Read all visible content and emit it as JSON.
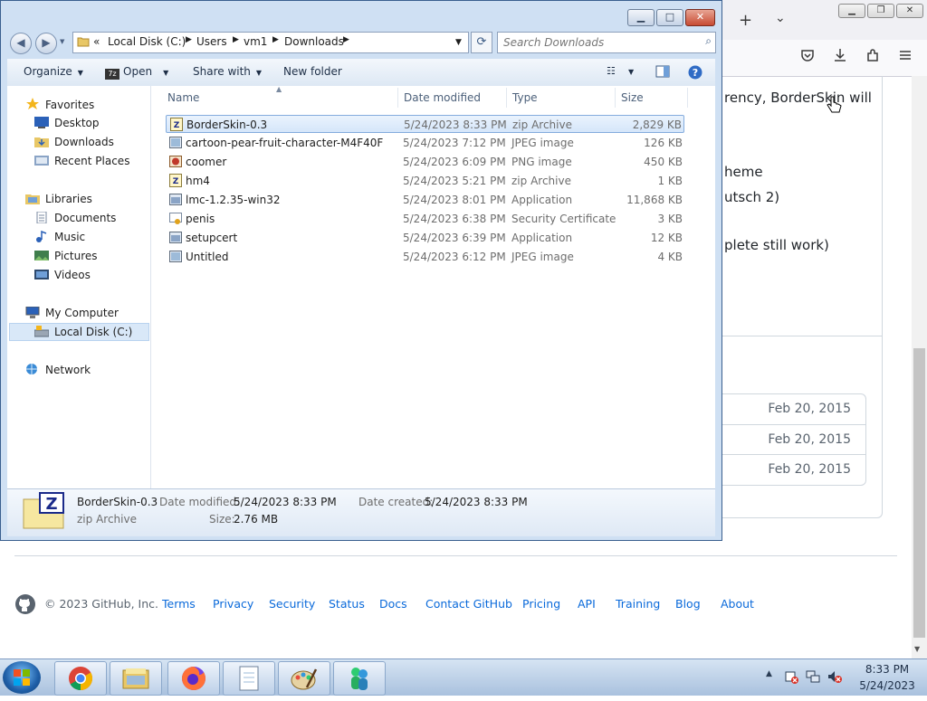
{
  "firefox": {
    "new_tab_icon": "plus-icon",
    "tab_list_icon": "chevron-down-icon",
    "toolbar_icons": [
      "pocket-icon",
      "download-icon",
      "extensions-icon",
      "menu-icon"
    ],
    "window_buttons": {
      "minimize": "minimize-icon",
      "restore": "restore-icon",
      "close": "close-icon"
    }
  },
  "github_page": {
    "text_lines": [
      "rency, BorderSkin will",
      "heme",
      "utsch 2)",
      "plete still work)"
    ],
    "release_dates": [
      "Feb 20, 2015",
      "Feb 20, 2015",
      "Feb 20, 2015"
    ],
    "footer": {
      "copyright": "© 2023 GitHub, Inc.",
      "links": [
        "Terms",
        "Privacy",
        "Security",
        "Status",
        "Docs",
        "Contact GitHub",
        "Pricing",
        "API",
        "Training",
        "Blog",
        "About"
      ]
    }
  },
  "explorer": {
    "breadcrumb": {
      "overflow": "«",
      "parts": [
        "Local Disk (C:)",
        "Users",
        "vm1",
        "Downloads"
      ]
    },
    "search_placeholder": "Search Downloads",
    "commands": {
      "organize": "Organize",
      "open": "Open",
      "share_with": "Share with",
      "new_folder": "New folder"
    },
    "nav": {
      "favorites_header": "Favorites",
      "favorites": [
        "Desktop",
        "Downloads",
        "Recent Places"
      ],
      "libraries_header": "Libraries",
      "libraries": [
        "Documents",
        "Music",
        "Pictures",
        "Videos"
      ],
      "computer_header": "My Computer",
      "computer_items": [
        "Local Disk (C:)"
      ],
      "network": "Network"
    },
    "columns": {
      "name": "Name",
      "date_modified": "Date modified",
      "type": "Type",
      "size": "Size"
    },
    "files": [
      {
        "name": "BorderSkin-0.3",
        "date": "5/24/2023 8:33 PM",
        "type": "zip Archive",
        "size": "2,829 KB",
        "icon": "zip-archive-icon"
      },
      {
        "name": "cartoon-pear-fruit-character-M4F40F",
        "date": "5/24/2023 7:12 PM",
        "type": "JPEG image",
        "size": "126 KB",
        "icon": "jpeg-image-icon"
      },
      {
        "name": "coomer",
        "date": "5/24/2023 6:09 PM",
        "type": "PNG image",
        "size": "450 KB",
        "icon": "png-image-icon"
      },
      {
        "name": "hm4",
        "date": "5/24/2023 5:21 PM",
        "type": "zip Archive",
        "size": "1 KB",
        "icon": "zip-archive-icon"
      },
      {
        "name": "lmc-1.2.35-win32",
        "date": "5/24/2023 8:01 PM",
        "type": "Application",
        "size": "11,868 KB",
        "icon": "application-icon"
      },
      {
        "name": "penis",
        "date": "5/24/2023 6:38 PM",
        "type": "Security Certificate",
        "size": "3 KB",
        "icon": "certificate-icon"
      },
      {
        "name": "setupcert",
        "date": "5/24/2023 6:39 PM",
        "type": "Application",
        "size": "12 KB",
        "icon": "application-icon"
      },
      {
        "name": "Untitled",
        "date": "5/24/2023 6:12 PM",
        "type": "JPEG image",
        "size": "4 KB",
        "icon": "jpeg-image-icon"
      }
    ],
    "details": {
      "name": "BorderSkin-0.3",
      "type": "zip Archive",
      "date_modified_label": "Date modified:",
      "date_modified": "5/24/2023 8:33 PM",
      "size_label": "Size:",
      "size": "2.76 MB",
      "date_created_label": "Date created:",
      "date_created": "5/24/2023 8:33 PM"
    }
  },
  "taskbar": {
    "apps": [
      "chrome-icon",
      "file-explorer-icon",
      "firefox-icon",
      "notepad-icon",
      "paint-icon",
      "messenger-icon"
    ],
    "tray_icons": [
      "show-hidden-icons-icon",
      "action-center-icon",
      "network-icon",
      "volume-icon"
    ],
    "time": "8:33 PM",
    "date": "5/24/2023"
  },
  "colors": {
    "link": "#0969da",
    "selection": "#d5e6fa",
    "taskbar": "#bcd0e8"
  }
}
